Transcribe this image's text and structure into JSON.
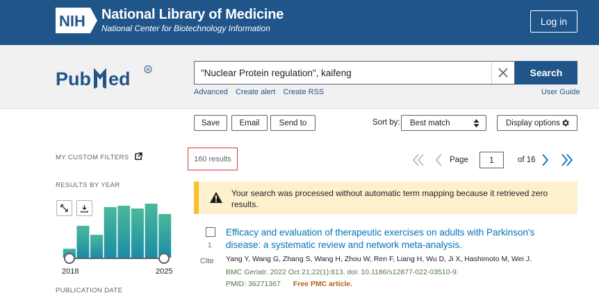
{
  "header": {
    "logo_text": "NIH",
    "title": "National Library of Medicine",
    "subtitle": "National Center for Biotechnology Information",
    "login_label": "Log in"
  },
  "search": {
    "logo_text": "PubMed",
    "query": "\"Nuclear Protein regulation\", kaifeng",
    "search_label": "Search",
    "links": [
      "Advanced",
      "Create alert",
      "Create RSS"
    ],
    "user_guide": "User Guide"
  },
  "toolbar": {
    "save_label": "Save",
    "email_label": "Email",
    "send_to_label": "Send to",
    "sort_label": "Sort by:",
    "sort_value": "Best match",
    "display_options_label": "Display options"
  },
  "sidebar": {
    "custom_filters_label": "MY CUSTOM FILTERS",
    "results_by_year_label": "RESULTS BY YEAR",
    "year_start": "2018",
    "year_end": "2025",
    "publication_date_label": "PUBLICATION DATE"
  },
  "chart_data": {
    "type": "bar",
    "categories": [
      "2018",
      "2019",
      "2020",
      "2021",
      "2022",
      "2023",
      "2024",
      "2025"
    ],
    "values": [
      13,
      46,
      33,
      73,
      75,
      71,
      78,
      63
    ],
    "ylim": [
      0,
      80
    ],
    "colors": {
      "bar_top": "#4bb89b",
      "bar_bottom": "#1b8ca6"
    }
  },
  "results": {
    "count_label": "160 results",
    "page_label": "Page",
    "current_page": "1",
    "total_pages_label": "of 16"
  },
  "notice": {
    "text": "Your search was processed without automatic term mapping because it retrieved zero results."
  },
  "articles": [
    {
      "number": "1",
      "cite_label": "Cite",
      "title": "Efficacy and evaluation of therapeutic exercises on adults with Parkinson's disease: a systematic review and network meta-analysis.",
      "authors": "Yang Y, Wang G, Zhang S, Wang H, Zhou W, Ren F, Liang H, Wu D, Ji X, Hashimoto M, Wei J.",
      "journal": "BMC Geriatr. 2022 Oct 21;22(1):813. doi: 10.1186/s12877-022-03510-9.",
      "pmid": "PMID: 36271367",
      "free_label": "Free PMC article."
    }
  ],
  "colors": {
    "nih_blue": "#20558a",
    "link_blue": "#0071bc",
    "warning_bg": "#fdf0cd",
    "warning_border": "#ffbe2e",
    "highlight_red": "#d83933"
  }
}
